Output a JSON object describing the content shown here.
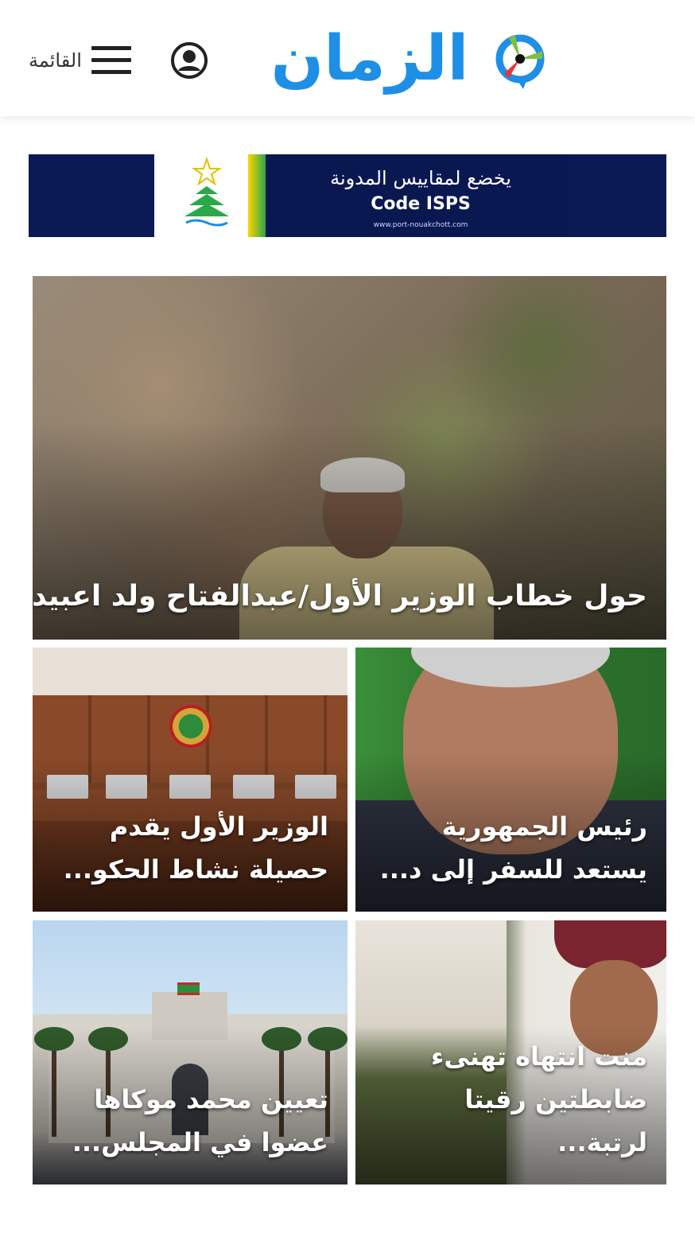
{
  "header": {
    "menu_label": "القائمة",
    "logo_text": "الزمان",
    "icons": {
      "menu": "hamburger-icon",
      "user": "user-icon",
      "logo_mark": "logo-mark"
    },
    "colors": {
      "logo_blue": "#1e8fe6",
      "logo_green": "#7ac143",
      "logo_red": "#e53935"
    }
  },
  "banner": {
    "line1": "يخضع لمقاييس المدونة",
    "line2": "Code ISPS",
    "url": "www.port-nouakchott.com",
    "colors": {
      "background": "#0b1a55"
    }
  },
  "articles": {
    "featured": {
      "title": "حول خطاب الوزير الأول/عبدالفتاح ولد اعبيدن"
    },
    "items": [
      {
        "title": "رئيس الجمهورية يستعد للسفر إلى د..."
      },
      {
        "title": "الوزير الأول يقدم حصيلة نشاط الحكو..."
      },
      {
        "title": "منت انتهاه تهنىء ضابطتين رقيتا لرتبة..."
      },
      {
        "title": "تعيين محمد موكاها عضوا في المجلس..."
      }
    ]
  }
}
